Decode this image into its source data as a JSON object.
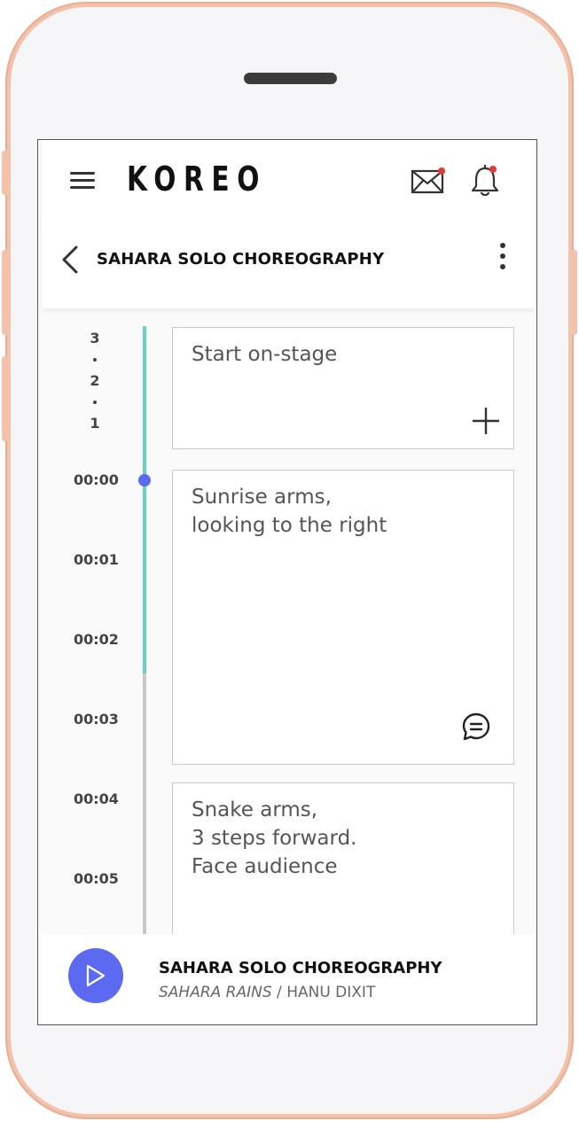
{
  "app": {
    "logo": "KOREO",
    "accent": "#5b6af0",
    "progress_color": "#6cd0bd",
    "notification_color": "#e53935"
  },
  "header": {
    "menu_icon": "hamburger-menu-icon",
    "mail_icon": "mail-icon",
    "bell_icon": "bell-icon"
  },
  "subheader": {
    "back_icon": "chevron-left-icon",
    "title": "SAHARA SOLO CHOREOGRAPHY",
    "more_icon": "more-vertical-icon"
  },
  "timeline": {
    "countdown": [
      "3",
      "2",
      "1"
    ],
    "times": [
      "00:00",
      "00:01",
      "00:02",
      "00:03",
      "00:04",
      "00:05"
    ],
    "current_time": "00:00"
  },
  "cards": [
    {
      "text": "Start on-stage",
      "action_icon": "plus-icon"
    },
    {
      "text": "Sunrise arms,\nlooking to the right",
      "action_icon": "comment-icon"
    },
    {
      "text": "Snake arms,\n3 steps forward.\nFace audience"
    }
  ],
  "player": {
    "play_icon": "play-icon",
    "title": "SAHARA SOLO CHOREOGRAPHY",
    "song": "SAHARA RAINS",
    "separator": " / ",
    "artist": "HANU DIXIT"
  }
}
